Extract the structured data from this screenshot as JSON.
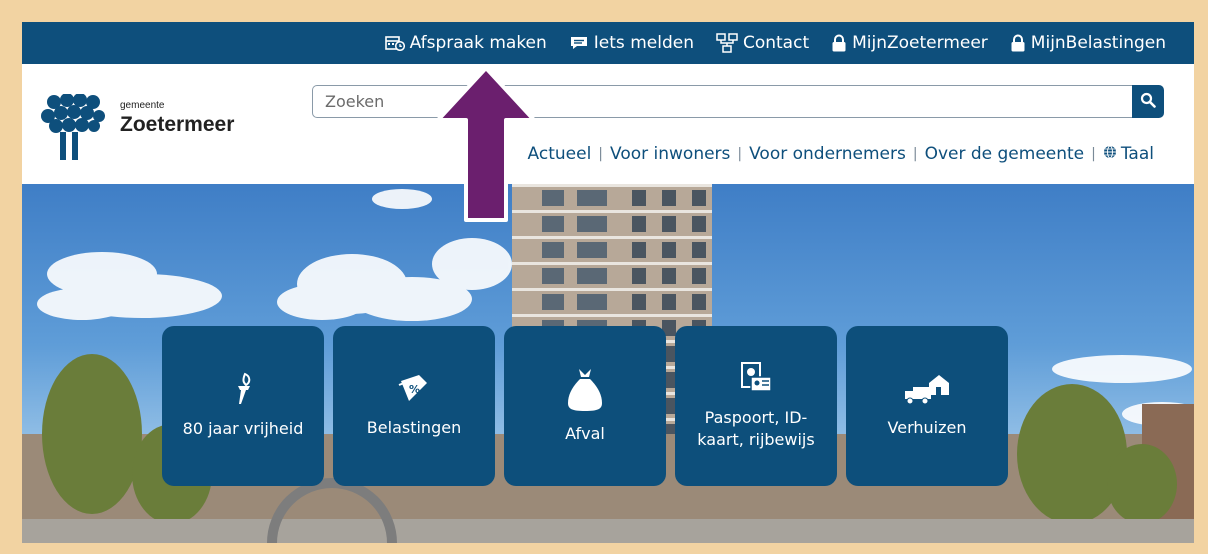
{
  "colors": {
    "brand": "#0e4f7c",
    "tile": "#0d4f7b",
    "arrow": "#6b1f6e",
    "border": "#f2d3a2"
  },
  "topbar": {
    "links": [
      {
        "label": "Afspraak maken",
        "icon": "calendar-clock-icon"
      },
      {
        "label": "Iets melden",
        "icon": "chat-bubble-icon"
      },
      {
        "label": "Contact",
        "icon": "contact-network-icon"
      },
      {
        "label": "MijnZoetermeer",
        "icon": "lock-icon"
      },
      {
        "label": "MijnBelastingen",
        "icon": "lock-icon"
      }
    ]
  },
  "logo": {
    "small": "gemeente",
    "big": "Zoetermeer",
    "icon": "zoetermeer-tree-logo"
  },
  "search": {
    "placeholder": "Zoeken",
    "value": "",
    "icon": "search-icon"
  },
  "nav": {
    "items": [
      {
        "label": "Actueel"
      },
      {
        "label": "Voor inwoners"
      },
      {
        "label": "Voor ondernemers"
      },
      {
        "label": "Over de gemeente"
      },
      {
        "label": "Taal",
        "icon": "globe-icon"
      }
    ]
  },
  "tiles": [
    {
      "label": "80 jaar vrijheid",
      "icon": "torch-icon"
    },
    {
      "label": "Belastingen",
      "icon": "tax-document-icon"
    },
    {
      "label": "Afval",
      "icon": "garbage-bag-icon"
    },
    {
      "label": "Paspoort, ID-kaart, rijbewijs",
      "icon": "id-card-icon"
    },
    {
      "label": "Verhuizen",
      "icon": "moving-truck-icon"
    }
  ],
  "annotation": {
    "icon": "up-arrow-icon"
  }
}
